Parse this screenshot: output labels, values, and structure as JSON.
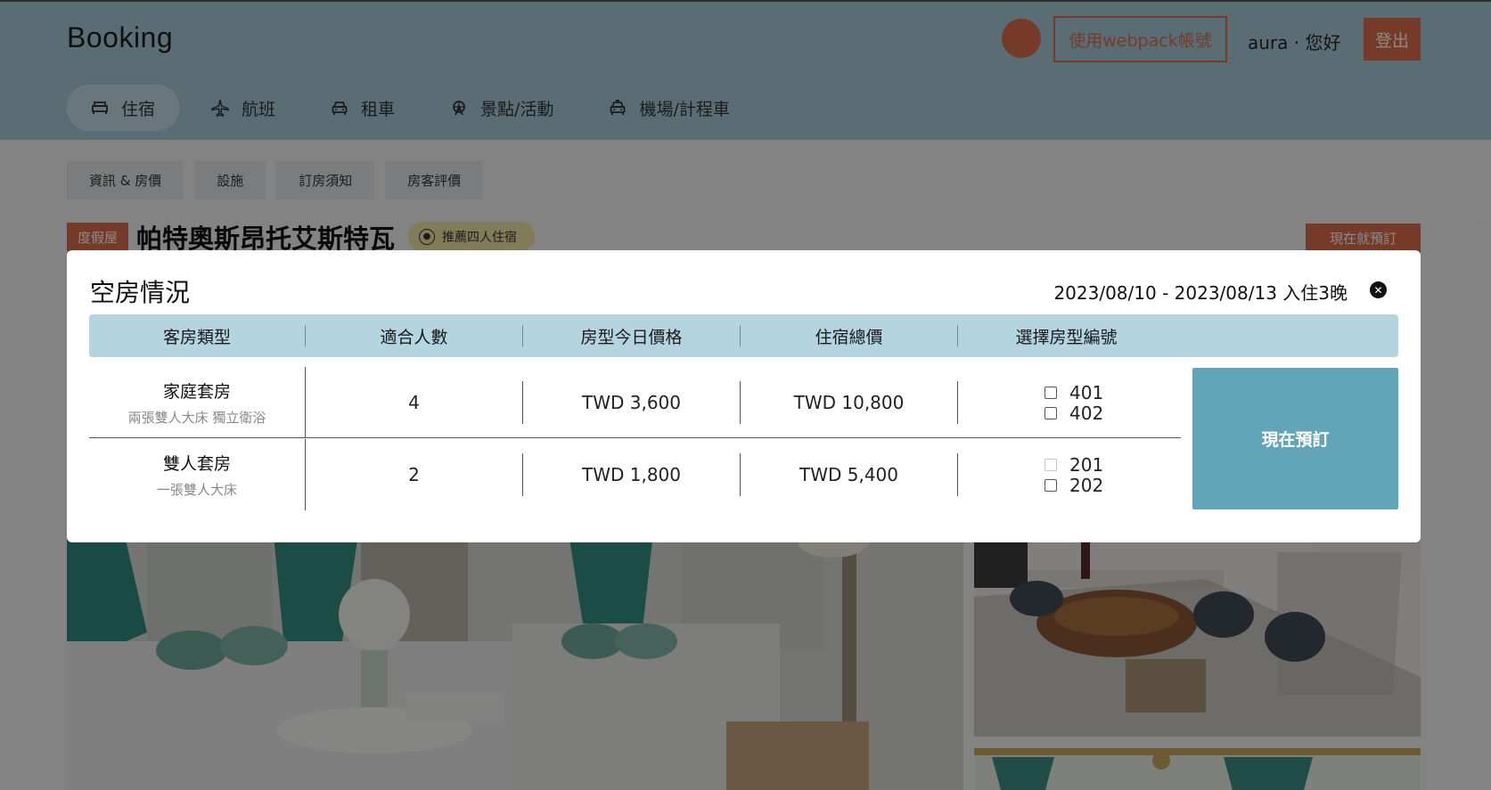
{
  "header": {
    "brand": "Booking",
    "webpack_button": "使用webpack帳號",
    "greeting": "aura · 您好",
    "logout_button": "登出"
  },
  "nav": {
    "items": [
      {
        "label": "住宿",
        "icon": "bed-icon",
        "active": true
      },
      {
        "label": "航班",
        "icon": "airplane-icon",
        "active": false
      },
      {
        "label": "租車",
        "icon": "car-icon",
        "active": false
      },
      {
        "label": "景點/活動",
        "icon": "ferris-wheel-icon",
        "active": false
      },
      {
        "label": "機場/計程車",
        "icon": "taxi-icon",
        "active": false
      }
    ]
  },
  "subtabs": [
    "資訊 & 房價",
    "設施",
    "訂房須知",
    "房客評價"
  ],
  "listing": {
    "type_badge": "度假屋",
    "title": "帕特奧斯昂托艾斯特瓦",
    "recommend_badge": "推薦四人住宿",
    "book_now_top": "現在就預訂"
  },
  "modal": {
    "title": "空房情況",
    "dates": "2023/08/10 - 2023/08/13 入住3晚",
    "headers": [
      "客房類型",
      "適合人數",
      "房型今日價格",
      "住宿總價",
      "選擇房型編號"
    ],
    "rows": [
      {
        "name": "家庭套房",
        "desc": "兩張雙人大床 獨立衛浴",
        "capacity": "4",
        "price_today": "TWD 3,600",
        "total_price": "TWD 10,800",
        "rooms": [
          {
            "number": "401",
            "disabled": false
          },
          {
            "number": "402",
            "disabled": false
          }
        ]
      },
      {
        "name": "雙人套房",
        "desc": "一張雙人大床",
        "capacity": "2",
        "price_today": "TWD 1,800",
        "total_price": "TWD 5,400",
        "rooms": [
          {
            "number": "201",
            "disabled": true
          },
          {
            "number": "202",
            "disabled": false
          }
        ]
      }
    ],
    "book_button": "現在預訂"
  },
  "colors": {
    "header_bg": "#a9cad6",
    "accent": "#d96b4b",
    "table_header": "#b4d5e0",
    "book_button": "#62a5b8"
  }
}
